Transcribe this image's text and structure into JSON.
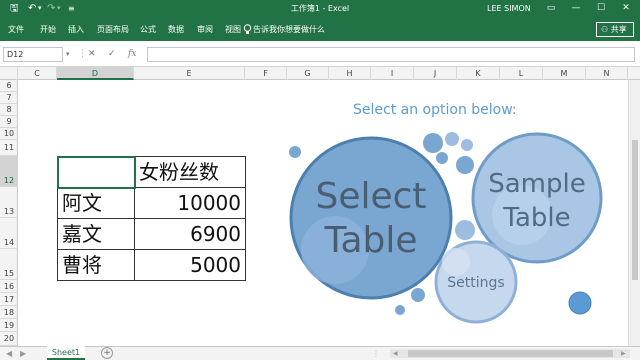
{
  "titlebar": {
    "doc_title": "工作簿1 - Excel",
    "user": "LEE SIMON",
    "save_icon": "save-icon",
    "undo_icon": "undo-icon",
    "redo_icon": "redo-icon",
    "customize_icon": "customize-quick-access-icon",
    "controls": {
      "ribbon_options": "▭",
      "minimize": "—",
      "maximize": "☐",
      "close": "✕"
    }
  },
  "ribbon": {
    "tabs": [
      {
        "label": "文件"
      },
      {
        "label": "开始"
      },
      {
        "label": "插入"
      },
      {
        "label": "页面布局"
      },
      {
        "label": "公式"
      },
      {
        "label": "数据"
      },
      {
        "label": "审阅"
      },
      {
        "label": "视图"
      }
    ],
    "tell_me": "告诉我你想要做什么",
    "share": "共享"
  },
  "formula_bar": {
    "name_box": "D12",
    "cancel": "✕",
    "enter": "✓",
    "fx": "fx",
    "value": ""
  },
  "grid": {
    "columns": [
      "C",
      "D",
      "E",
      "F",
      "G",
      "H",
      "I",
      "J",
      "K",
      "L",
      "M",
      "N"
    ],
    "selected_column": "D",
    "rows": [
      "6",
      "7",
      "8",
      "9",
      "10",
      "11",
      "12",
      "13",
      "14",
      "15",
      "16",
      "17",
      "18",
      "19",
      "20"
    ],
    "selected_row": "12"
  },
  "table": {
    "header": [
      "",
      "女粉丝数"
    ],
    "rows": [
      {
        "name": "阿文",
        "value": "10000"
      },
      {
        "name": "嘉文",
        "value": "6900"
      },
      {
        "name": "曹将",
        "value": "5000"
      }
    ]
  },
  "welcome": {
    "prompt": "Select an option below:",
    "select_table": [
      "Select",
      "Table"
    ],
    "sample_table": [
      "Sample",
      "Table"
    ],
    "settings": "Settings",
    "colors": {
      "accent": "#5b9bd5",
      "bubble_fill": "#7aa6d2",
      "bubble_stroke": "#4d7fae",
      "light_fill": "#c5d8ee"
    }
  },
  "sheets": {
    "tabs": [
      "Sheet1"
    ],
    "active": "Sheet1",
    "add": "+"
  },
  "colors": {
    "brand": "#217346"
  }
}
